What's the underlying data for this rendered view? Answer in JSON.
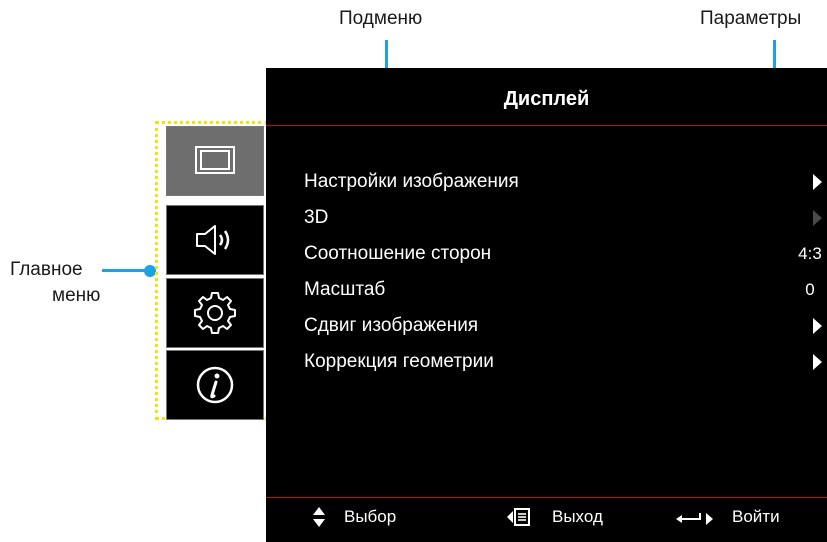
{
  "callouts": {
    "submenu": "Подменю",
    "options": "Параметры",
    "main_menu_line1": "Главное",
    "main_menu_line2": "меню"
  },
  "osd": {
    "title": "Дисплей",
    "items": [
      {
        "label": "Настройки изображения",
        "value": "",
        "arrow": true,
        "enabled": true
      },
      {
        "label": "3D",
        "value": "",
        "arrow": true,
        "enabled": false
      },
      {
        "label": "Соотношение сторон",
        "value": "4:3",
        "arrow": false,
        "enabled": true
      },
      {
        "label": "Масштаб",
        "value": "0",
        "arrow": false,
        "enabled": true
      },
      {
        "label": "Сдвиг изображения",
        "value": "",
        "arrow": true,
        "enabled": true
      },
      {
        "label": "Коррекция геометрии",
        "value": "",
        "arrow": true,
        "enabled": true
      }
    ],
    "footer": {
      "select": "Выбор",
      "exit": "Выход",
      "enter": "Войти"
    }
  },
  "sidebar": {
    "items": [
      {
        "icon": "display-icon",
        "active": true
      },
      {
        "icon": "speaker-icon",
        "active": false
      },
      {
        "icon": "gear-icon",
        "active": false
      },
      {
        "icon": "info-icon",
        "active": false
      }
    ]
  },
  "colors": {
    "accent": "#1ea0e6",
    "highlight_border": "#f2e600",
    "divider": "#b01818"
  }
}
